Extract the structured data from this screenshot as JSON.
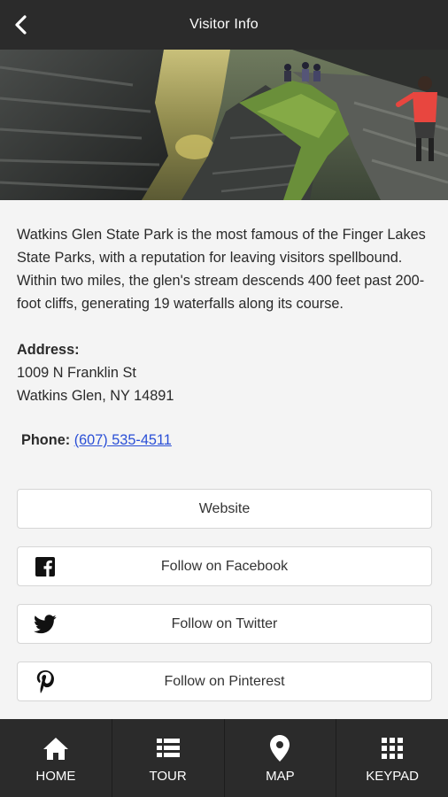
{
  "header": {
    "title": "Visitor Info",
    "back_icon": "chevron-left-icon"
  },
  "description": "Watkins Glen State Park is the most famous of the Finger Lakes State Parks, with a reputation for leaving visitors spellbound. Within two miles, the glen's stream descends 400 feet past 200-foot cliffs, generating 19 waterfalls along its course.",
  "address": {
    "label": "Address:",
    "line1": "1009 N Franklin St",
    "line2": "Watkins Glen, NY 14891"
  },
  "phone": {
    "label": "Phone:",
    "number": "(607) 535-4511"
  },
  "buttons": {
    "website": "Website",
    "facebook": "Follow on Facebook",
    "twitter": "Follow on Twitter",
    "pinterest": "Follow on Pinterest"
  },
  "tabs": [
    {
      "label": "HOME",
      "icon": "home-icon"
    },
    {
      "label": "TOUR",
      "icon": "list-icon"
    },
    {
      "label": "MAP",
      "icon": "map-pin-icon"
    },
    {
      "label": "KEYPAD",
      "icon": "keypad-icon"
    }
  ],
  "colors": {
    "bar": "#2b2b2b",
    "link": "#2a4fd6",
    "background": "#f4f4f4"
  }
}
